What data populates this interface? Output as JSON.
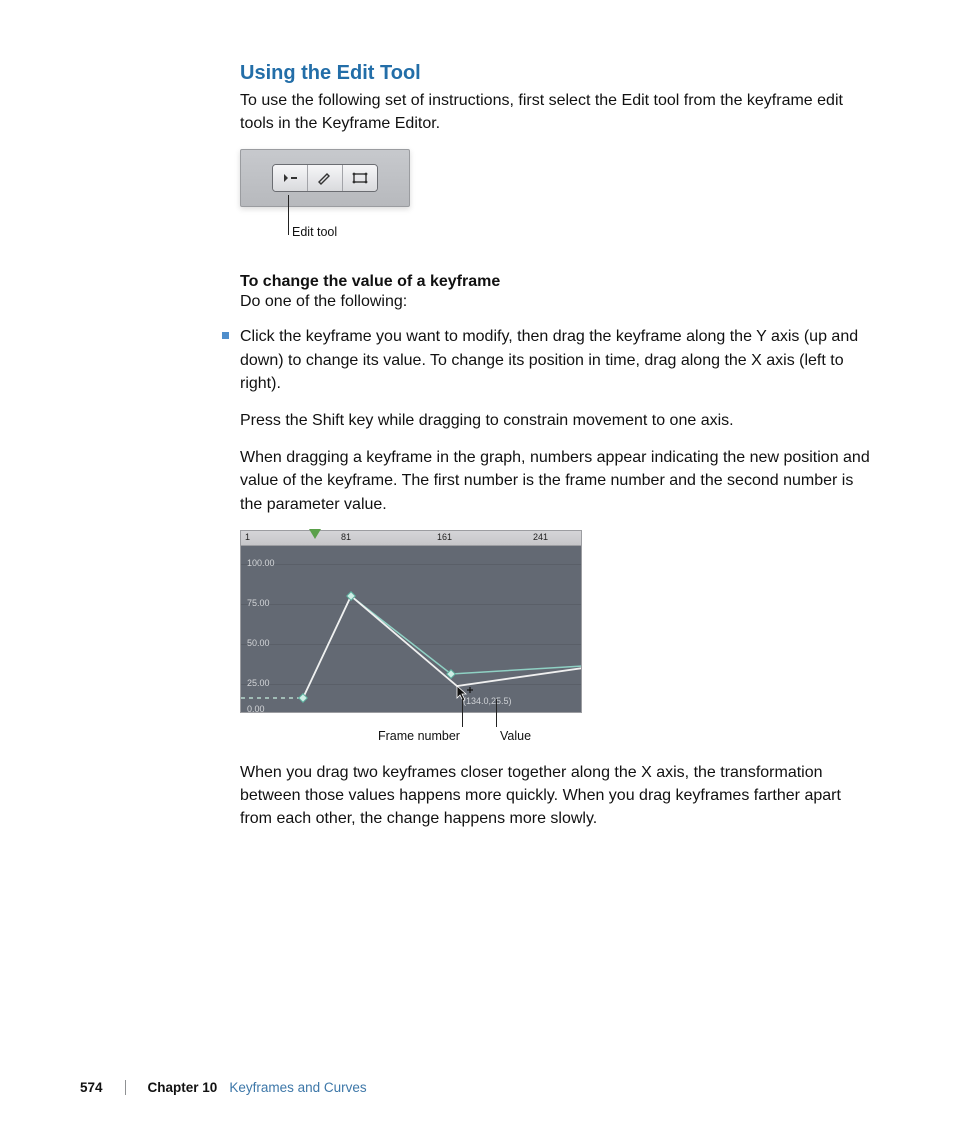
{
  "heading": "Using the Edit Tool",
  "intro": "To use the following set of instructions, first select the Edit tool from the keyframe edit tools in the Keyframe Editor.",
  "fig1": {
    "callout": "Edit tool"
  },
  "sub": {
    "title": "To change the value of a keyframe",
    "line": "Do one of the following:"
  },
  "bullet": "Click the keyframe you want to modify, then drag the keyframe along the Y axis (up and down) to change its value. To change its position in time, drag along the X axis (left to right).",
  "p2": "Press the Shift key while dragging to constrain movement to one axis.",
  "p3": "When dragging a keyframe in the graph, numbers appear indicating the new position and value of the keyframe. The first number is the frame number and the second number is the parameter value.",
  "fig2": {
    "ruler": {
      "t1": "1",
      "t81": "81",
      "t161": "161",
      "t241": "241"
    },
    "yaxis": {
      "y100": "100.00",
      "y75": "75.00",
      "y50": "50.00",
      "y25": "25.00",
      "y0": "0.00"
    },
    "tooltip": "(134.0,25.5)",
    "callout_frame": "Frame number",
    "callout_value": "Value"
  },
  "p4": "When you drag two keyframes closer together along the X axis, the transformation between those values happens more quickly. When you drag keyframes farther apart from each other, the change happens more slowly.",
  "footer": {
    "page": "574",
    "chapter": "Chapter 10",
    "title": "Keyframes and Curves"
  }
}
